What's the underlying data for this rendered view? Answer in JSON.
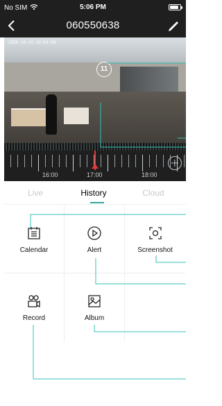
{
  "status_bar": {
    "carrier": "No SIM",
    "time": "5:06 PM",
    "wifi_icon": "wifi-icon",
    "battery_icon": "battery-icon"
  },
  "nav": {
    "title": "060550638",
    "back_icon": "chevron-left-icon",
    "edit_icon": "pen-icon"
  },
  "video": {
    "timestamp": "2020-10-15 10:54:48",
    "marker_text": "11"
  },
  "timeline": {
    "labels": [
      "16:00",
      "17:00",
      "18:00"
    ]
  },
  "tabs": [
    {
      "label": "Live"
    },
    {
      "label": "History"
    },
    {
      "label": "Cloud"
    }
  ],
  "grid": {
    "items": [
      {
        "label": "Calendar",
        "icon": "calendar-icon"
      },
      {
        "label": "Alert",
        "icon": "play-circle-icon"
      },
      {
        "label": "Screenshot",
        "icon": "screenshot-icon"
      },
      {
        "label": "Record",
        "icon": "video-record-icon"
      },
      {
        "label": "Album",
        "icon": "photo-album-icon"
      }
    ]
  },
  "colors": {
    "accent": "#2ea79a",
    "dark_bar": "#1f1f1f",
    "playhead": "#e53935"
  }
}
